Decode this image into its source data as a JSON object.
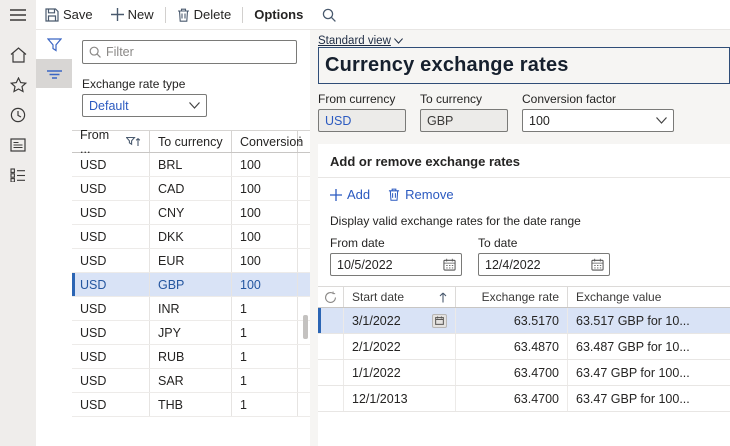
{
  "toolbar": {
    "save": "Save",
    "new": "New",
    "delete": "Delete",
    "options": "Options"
  },
  "colors": {
    "accent": "#2b5ac0",
    "selection_bg": "#d9e3f6",
    "selection_bar": "#2b65b4",
    "title_border": "#2f4d77"
  },
  "left_panel": {
    "filter_placeholder": "Filter",
    "type_label": "Exchange rate type",
    "type_value": "Default",
    "grid": {
      "columns": [
        "From ...",
        "To currency",
        "Conversion"
      ],
      "rows": [
        [
          "USD",
          "BRL",
          "100"
        ],
        [
          "USD",
          "CAD",
          "100"
        ],
        [
          "USD",
          "CNY",
          "100"
        ],
        [
          "USD",
          "DKK",
          "100"
        ],
        [
          "USD",
          "EUR",
          "100"
        ],
        [
          "USD",
          "GBP",
          "100"
        ],
        [
          "USD",
          "INR",
          "1"
        ],
        [
          "USD",
          "JPY",
          "1"
        ],
        [
          "USD",
          "RUB",
          "1"
        ],
        [
          "USD",
          "SAR",
          "1"
        ],
        [
          "USD",
          "THB",
          "1"
        ]
      ],
      "selected_index": 5
    }
  },
  "main": {
    "view_label": "Standard view",
    "title": "Currency exchange rates",
    "fields": {
      "from_currency_label": "From currency",
      "from_currency_value": "USD",
      "to_currency_label": "To currency",
      "to_currency_value": "GBP",
      "conversion_factor_label": "Conversion factor",
      "conversion_factor_value": "100"
    },
    "section": {
      "title": "Add or remove exchange rates",
      "add_label": "Add",
      "remove_label": "Remove",
      "range_text": "Display valid exchange rates for the date range",
      "from_date_label": "From date",
      "from_date_value": "10/5/2022",
      "to_date_label": "To date",
      "to_date_value": "12/4/2022",
      "grid": {
        "columns": [
          "Start date",
          "Exchange rate",
          "Exchange value"
        ],
        "rows": [
          {
            "start_date": "3/1/2022",
            "rate": "63.5170",
            "value": "63.517 GBP for 10..."
          },
          {
            "start_date": "2/1/2022",
            "rate": "63.4870",
            "value": "63.487 GBP for 10..."
          },
          {
            "start_date": "1/1/2022",
            "rate": "63.4700",
            "value": "63.47 GBP for 100..."
          },
          {
            "start_date": "12/1/2013",
            "rate": "63.4700",
            "value": "63.47 GBP for 100..."
          }
        ],
        "selected_index": 0
      }
    }
  }
}
